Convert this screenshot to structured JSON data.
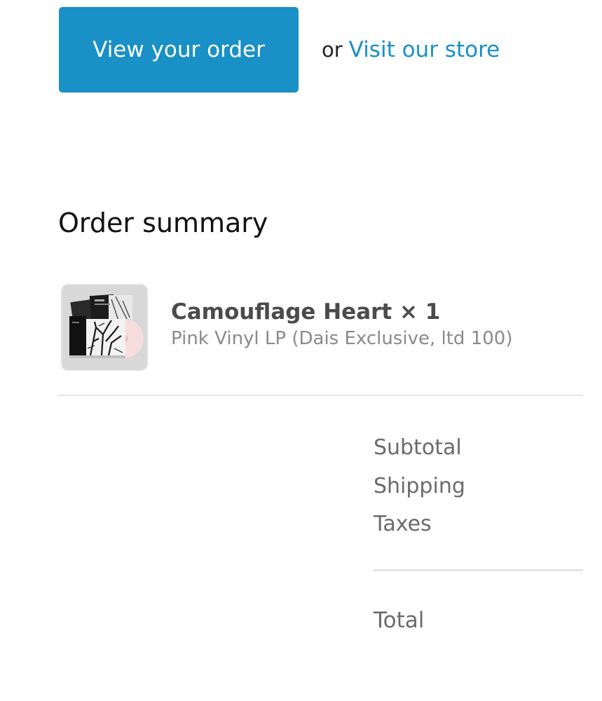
{
  "actions": {
    "view_order_label": "View your order",
    "or_text": "or",
    "visit_store_label": "Visit our store"
  },
  "order_summary": {
    "title": "Order summary",
    "items": [
      {
        "name": "Camouflage Heart × 1",
        "variant": "Pink Vinyl LP (Dais Exclusive, ltd 100)",
        "thumbnail": "vinyl-package-image"
      }
    ],
    "totals": {
      "subtotal_label": "Subtotal",
      "shipping_label": "Shipping",
      "taxes_label": "Taxes",
      "total_label": "Total"
    }
  },
  "colors": {
    "accent": "#1990c6",
    "text_primary": "#111111",
    "text_muted": "#8a8a8a"
  }
}
